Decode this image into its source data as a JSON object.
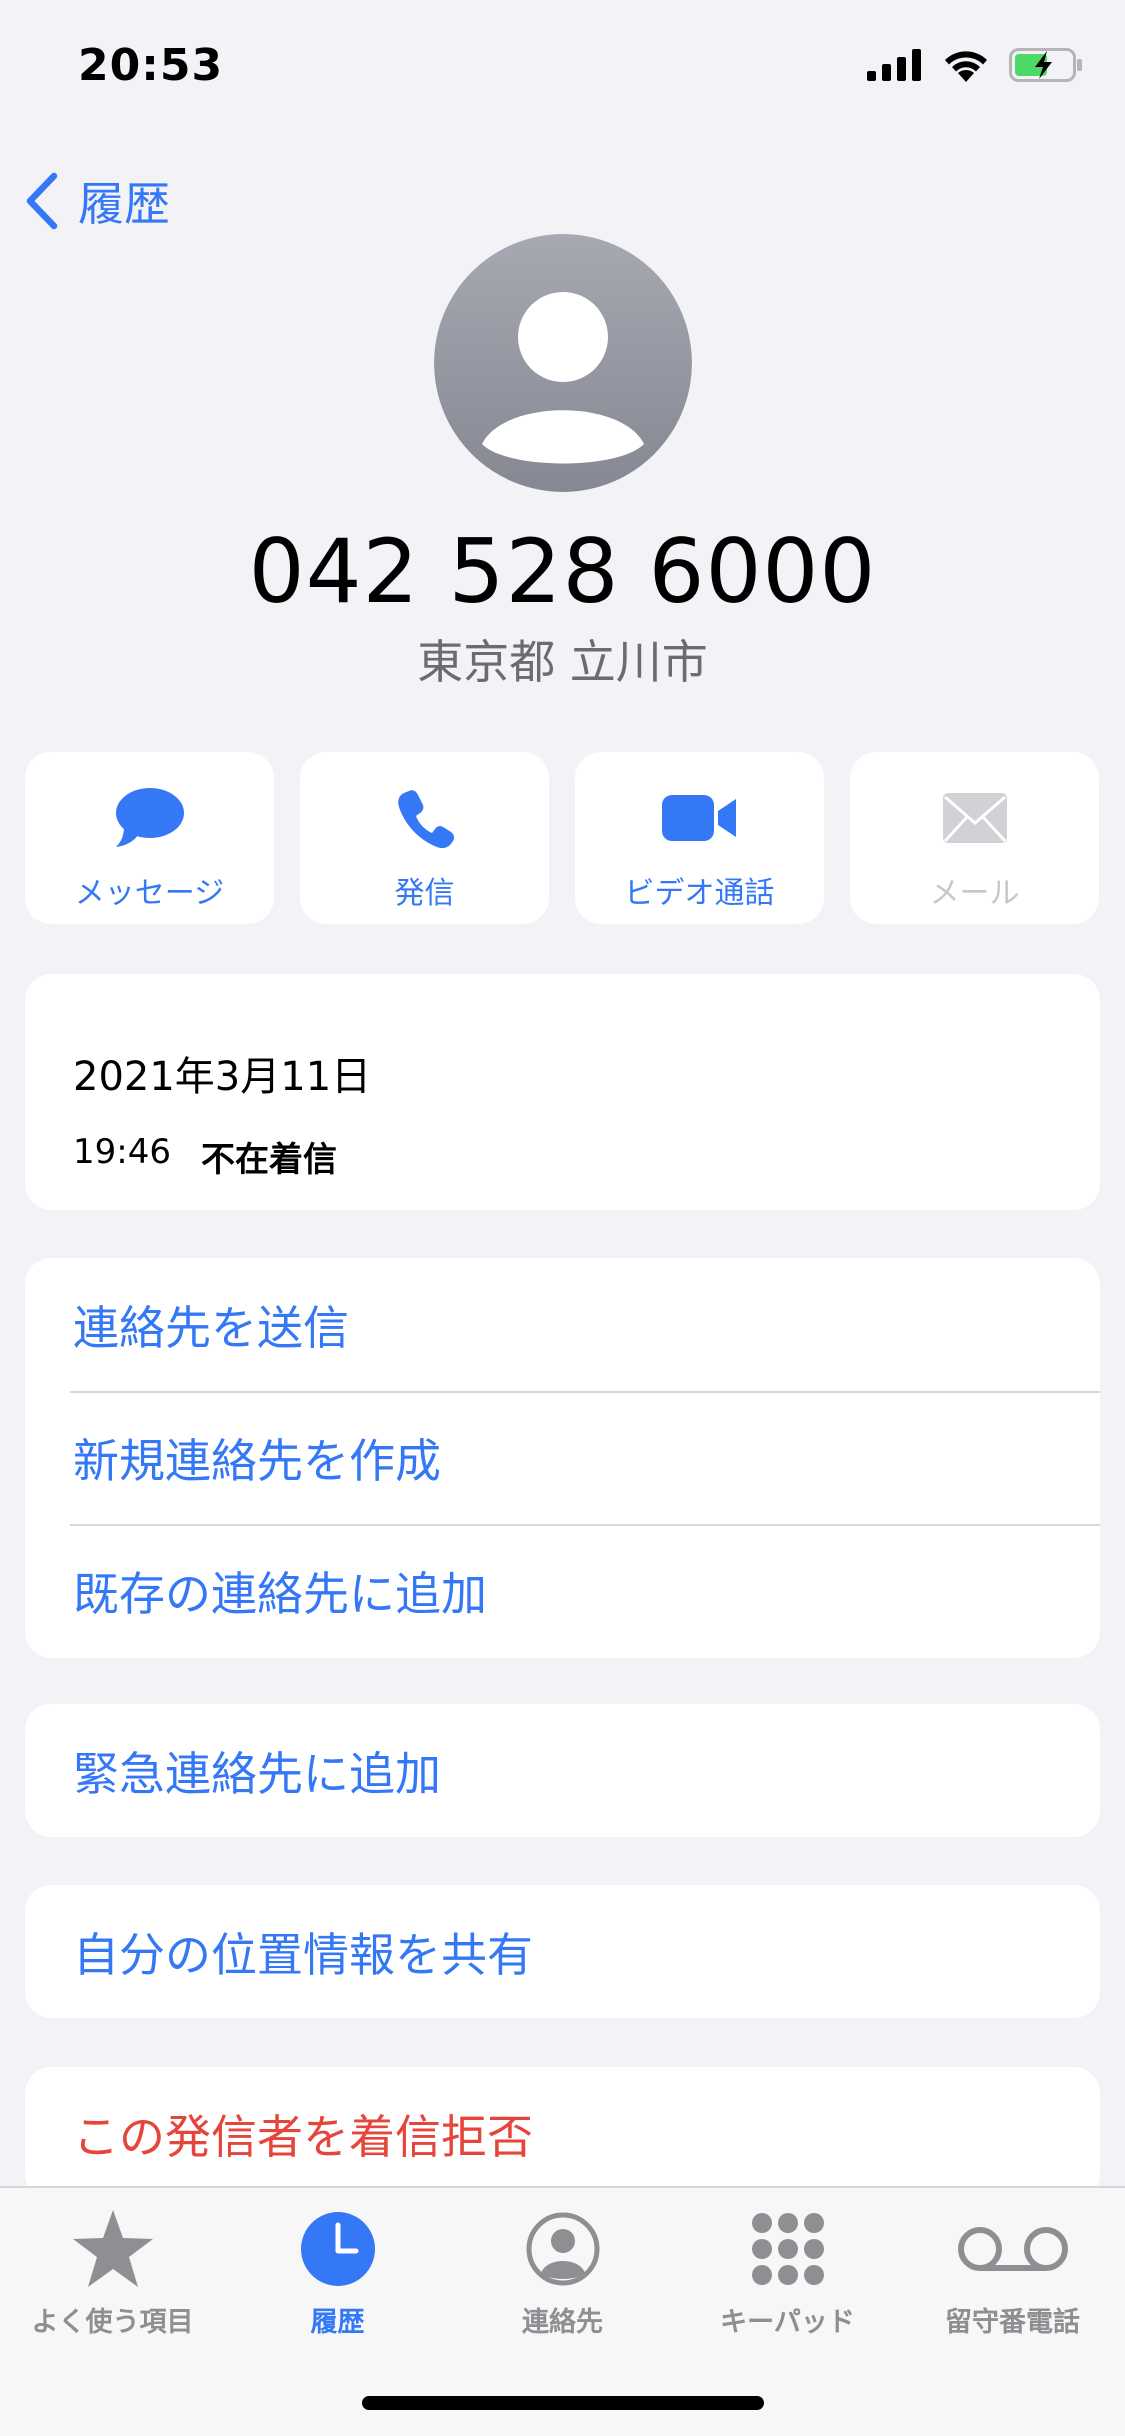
{
  "status_bar": {
    "time": "20:53"
  },
  "nav": {
    "back_label": "履歴"
  },
  "contact": {
    "phone_number": "042 528 6000",
    "location": "東京都 立川市"
  },
  "actions": [
    {
      "label": "メッセージ",
      "icon": "message-icon",
      "enabled": true
    },
    {
      "label": "発信",
      "icon": "phone-icon",
      "enabled": true
    },
    {
      "label": "ビデオ通話",
      "icon": "video-icon",
      "enabled": true
    },
    {
      "label": "メール",
      "icon": "mail-icon",
      "enabled": false
    }
  ],
  "history": {
    "date": "2021年3月11日",
    "time": "19:46",
    "type": "不在着信"
  },
  "menu": {
    "send_contact": "連絡先を送信",
    "create_contact": "新規連絡先を作成",
    "add_existing": "既存の連絡先に追加",
    "add_emergency": "緊急連絡先に追加",
    "share_location": "自分の位置情報を共有",
    "block_caller": "この発信者を着信拒否"
  },
  "tabs": [
    {
      "label": "よく使う項目",
      "icon": "star-icon",
      "active": false
    },
    {
      "label": "履歴",
      "icon": "clock-icon",
      "active": true
    },
    {
      "label": "連絡先",
      "icon": "person-circle-icon",
      "active": false
    },
    {
      "label": "キーパッド",
      "icon": "keypad-icon",
      "active": false
    },
    {
      "label": "留守番電話",
      "icon": "voicemail-icon",
      "active": false
    }
  ],
  "colors": {
    "accent": "#3478f6",
    "danger": "#e5453a",
    "background": "#f2f2f7",
    "inactive_tab": "#8e8e93",
    "battery_fill": "#4cd964"
  }
}
